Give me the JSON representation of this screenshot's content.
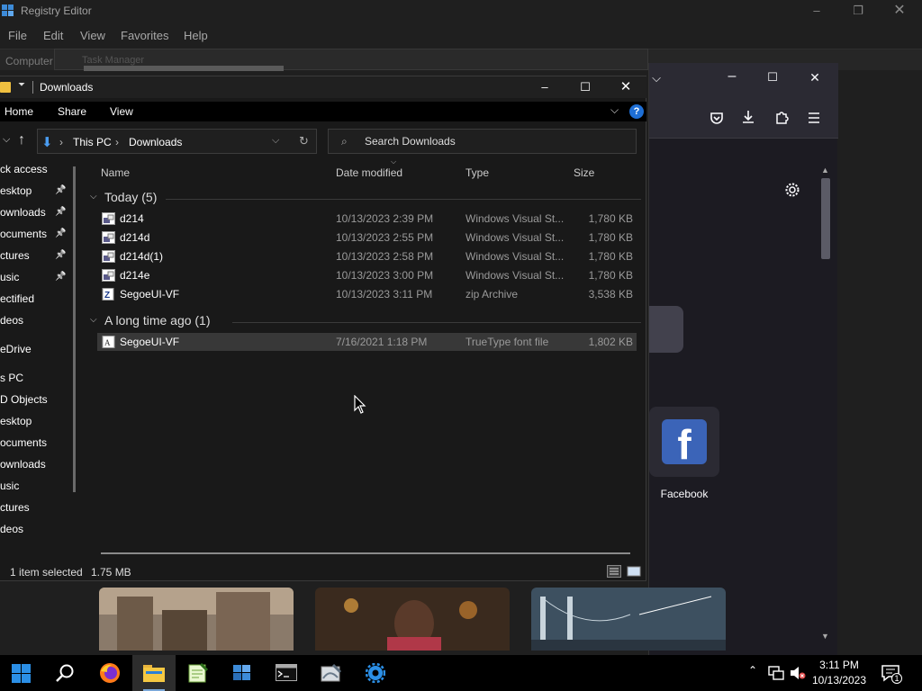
{
  "registry": {
    "title": "Registry Editor",
    "menu": [
      "File",
      "Edit",
      "View",
      "Favorites",
      "Help"
    ],
    "address": "Computer"
  },
  "task_manager_ghost": {
    "title": "Task Manager"
  },
  "firefox": {
    "shortcut_label": "Facebook",
    "fb_letter": "f"
  },
  "explorer": {
    "title": "Downloads",
    "ribbon_tabs": [
      "Home",
      "Share",
      "View"
    ],
    "help_glyph": "?",
    "breadcrumb": [
      "This PC",
      "Downloads"
    ],
    "search_placeholder": "Search Downloads",
    "nav_items": [
      {
        "label": "ck access",
        "pinned": false
      },
      {
        "label": "esktop",
        "pinned": true
      },
      {
        "label": "ownloads",
        "pinned": true
      },
      {
        "label": "ocuments",
        "pinned": true
      },
      {
        "label": "ctures",
        "pinned": true
      },
      {
        "label": "usic",
        "pinned": true
      },
      {
        "label": "ectified",
        "pinned": false
      },
      {
        "label": "deos",
        "pinned": false
      },
      {
        "label": "eDrive",
        "pinned": false
      },
      {
        "label": "s PC",
        "pinned": false
      },
      {
        "label": "D Objects",
        "pinned": false
      },
      {
        "label": "esktop",
        "pinned": false
      },
      {
        "label": "ocuments",
        "pinned": false
      },
      {
        "label": "ownloads",
        "pinned": false
      },
      {
        "label": "usic",
        "pinned": false
      },
      {
        "label": "ctures",
        "pinned": false
      },
      {
        "label": "deos",
        "pinned": false
      }
    ],
    "columns": [
      "Name",
      "Date modified",
      "Type",
      "Size"
    ],
    "groups": [
      {
        "title": "Today (5)",
        "files": [
          {
            "name": "d214",
            "date": "10/13/2023 2:39 PM",
            "type": "Windows Visual St...",
            "size": "1,780 KB",
            "icon": "vs-solution-icon"
          },
          {
            "name": "d214d",
            "date": "10/13/2023 2:55 PM",
            "type": "Windows Visual St...",
            "size": "1,780 KB",
            "icon": "vs-solution-icon"
          },
          {
            "name": "d214d(1)",
            "date": "10/13/2023 2:58 PM",
            "type": "Windows Visual St...",
            "size": "1,780 KB",
            "icon": "vs-solution-icon"
          },
          {
            "name": "d214e",
            "date": "10/13/2023 3:00 PM",
            "type": "Windows Visual St...",
            "size": "1,780 KB",
            "icon": "vs-solution-icon"
          },
          {
            "name": "SegoeUI-VF",
            "date": "10/13/2023 3:11 PM",
            "type": "zip Archive",
            "size": "3,538 KB",
            "icon": "zip-icon"
          }
        ]
      },
      {
        "title": "A long time ago (1)",
        "files": [
          {
            "name": "SegoeUI-VF",
            "date": "7/16/2021 1:18 PM",
            "type": "TrueType font file",
            "size": "1,802 KB",
            "icon": "font-file-icon",
            "selected": true
          }
        ]
      }
    ],
    "status": {
      "count": "1 item selected",
      "size": "1.75 MB"
    }
  },
  "taskbar": {
    "apps": [
      "start-icon",
      "search-icon",
      "firefox-icon",
      "file-explorer-icon",
      "notepad-plus-icon",
      "registry-editor-icon",
      "terminal-icon",
      "paint-icon",
      "settings-app-icon"
    ],
    "active": "file-explorer-icon",
    "clock_time": "3:11 PM",
    "clock_date": "10/13/2023",
    "notification_count": "1"
  },
  "colors": {
    "accent": "#1e6fd6",
    "facebook": "#3b64b8",
    "folder": "#f0c040"
  }
}
